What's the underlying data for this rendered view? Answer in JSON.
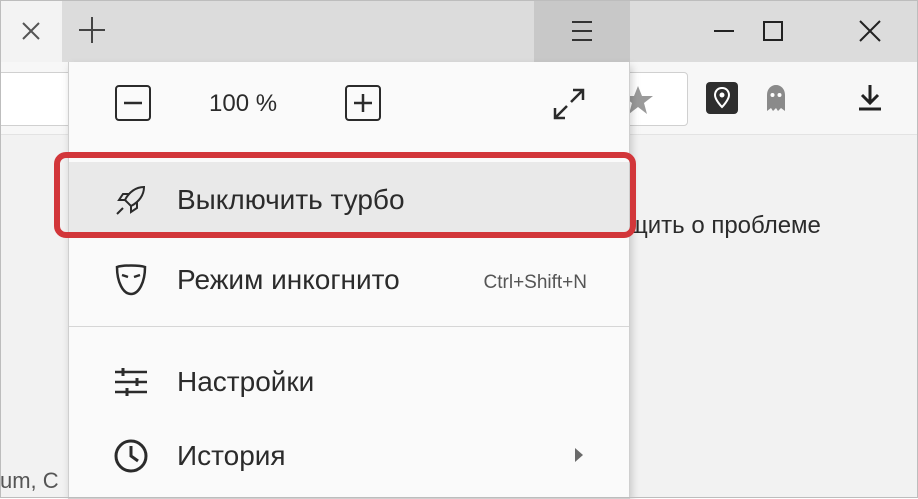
{
  "tabbar": {
    "close_icon": "close-icon",
    "new_tab_icon": "plus-icon",
    "menu_icon": "hamburger-icon"
  },
  "window_controls": [
    "minimize-icon",
    "maximize-icon",
    "close-icon"
  ],
  "toolbar": {
    "icons": [
      "star-icon",
      "map-pin-icon",
      "ghost-icon",
      "download-icon"
    ]
  },
  "page": {
    "report_text": "щить о проблеме",
    "snippet_text": "um, C"
  },
  "menu": {
    "zoom": {
      "level": "100 %",
      "minus_icon": "minus-icon",
      "plus_icon": "plus-icon",
      "fullscreen_icon": "fullscreen-icon"
    },
    "items": [
      {
        "label": "Выключить турбо",
        "icon": "rocket-icon",
        "shortcut": "",
        "highlighted": true
      },
      {
        "label": "Режим инкогнито",
        "icon": "mask-icon",
        "shortcut": "Ctrl+Shift+N"
      },
      {
        "label": "Настройки",
        "icon": "sliders-icon",
        "shortcut": ""
      },
      {
        "label": "История",
        "icon": "clock-icon",
        "shortcut": "",
        "submenu": true
      }
    ]
  },
  "colors": {
    "highlight": "#d2363a",
    "tabbar": "#dcdcdc",
    "menu_bg": "#fafafa"
  }
}
